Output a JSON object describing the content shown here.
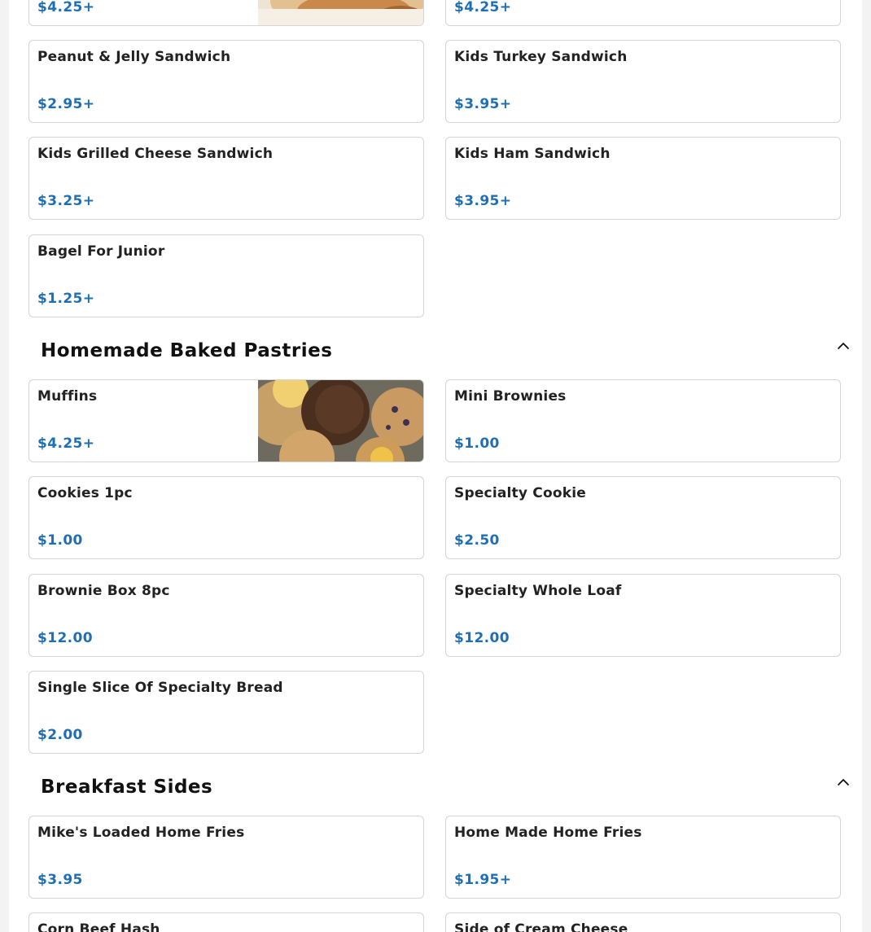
{
  "kids_menu": {
    "items": [
      {
        "name": "",
        "price": "$4.25+"
      },
      {
        "name": "",
        "price": "$4.25+"
      },
      {
        "name": "Peanut & Jelly Sandwich",
        "price": "$2.95+"
      },
      {
        "name": "Kids Turkey Sandwich",
        "price": "$3.95+"
      },
      {
        "name": "Kids Grilled Cheese Sandwich",
        "price": "$3.25+"
      },
      {
        "name": "Kids Ham Sandwich",
        "price": "$3.95+"
      },
      {
        "name": "Bagel For Junior",
        "price": "$1.25+"
      }
    ]
  },
  "pastries": {
    "title": "Homemade Baked Pastries",
    "toggle_icon": "chevron-up-icon",
    "items": [
      {
        "name": "Muffins",
        "price": "$4.25+"
      },
      {
        "name": "Mini Brownies",
        "price": "$1.00"
      },
      {
        "name": "Cookies 1pc",
        "price": "$1.00"
      },
      {
        "name": "Specialty Cookie",
        "price": "$2.50"
      },
      {
        "name": "Brownie Box 8pc",
        "price": "$12.00"
      },
      {
        "name": "Specialty Whole Loaf",
        "price": "$12.00"
      },
      {
        "name": "Single Slice Of Specialty Bread",
        "price": "$2.00"
      }
    ]
  },
  "breakfast_sides": {
    "title": "Breakfast Sides",
    "toggle_icon": "chevron-up-icon",
    "items": [
      {
        "name": "Mike's Loaded Home Fries",
        "price": "$3.95"
      },
      {
        "name": "Home Made Home Fries",
        "price": "$1.95+"
      },
      {
        "name": "Corn Beef Hash",
        "price": ""
      },
      {
        "name": "Side of Cream Cheese",
        "price": ""
      }
    ]
  },
  "colors": {
    "price": "#1f6fb5",
    "card_border": "#d5d5d5",
    "heading": "#111111"
  }
}
